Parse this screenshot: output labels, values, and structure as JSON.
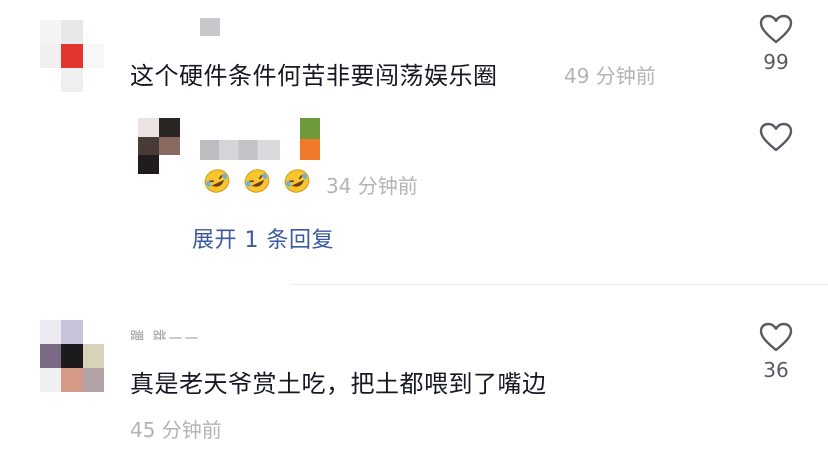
{
  "comments": [
    {
      "text": "这个硬件条件何苦非要闯荡娱乐圈",
      "time": "49 分钟前",
      "likes": "99",
      "reply": {
        "time": "34 分钟前",
        "emoji_icon": "rofl-emoji-icon"
      },
      "expand_label": "展开 1 条回复"
    },
    {
      "username_fragment": "蹦 跳——",
      "text": "真是老天爷赏土吃，把土都喂到了嘴边",
      "time": "45 分钟前",
      "likes": "36"
    }
  ],
  "icons": {
    "like": "heart-outline-icon"
  },
  "colors": {
    "text": "#161823",
    "time": "#b3b3b8",
    "link": "#3b5aa0",
    "like_count": "#5a5a62"
  }
}
